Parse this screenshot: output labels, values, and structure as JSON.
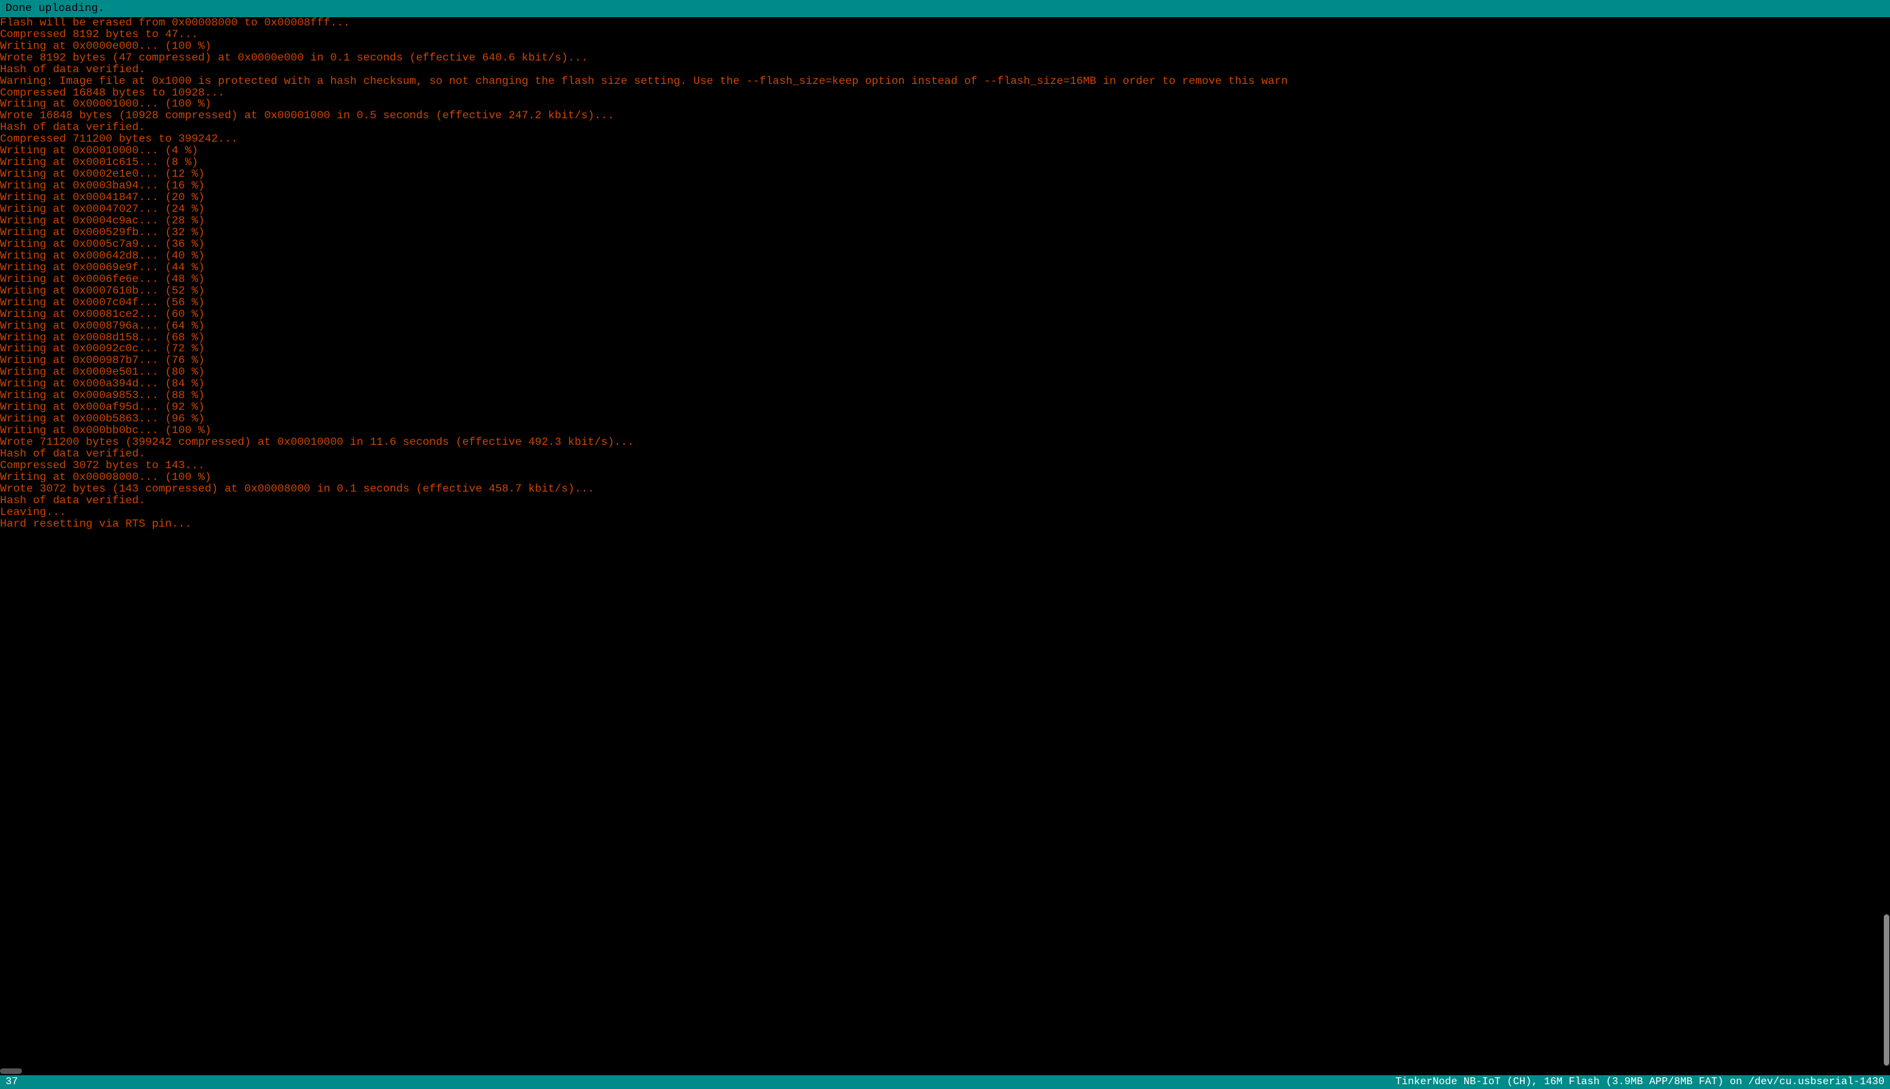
{
  "titleBar": "Done uploading.",
  "lines": [
    "Flash will be erased from 0x00008000 to 0x00008fff...",
    "Compressed 8192 bytes to 47...",
    "Writing at 0x0000e000... (100 %)",
    "Wrote 8192 bytes (47 compressed) at 0x0000e000 in 0.1 seconds (effective 640.6 kbit/s)...",
    "Hash of data verified.",
    "Warning: Image file at 0x1000 is protected with a hash checksum, so not changing the flash size setting. Use the --flash_size=keep option instead of --flash_size=16MB in order to remove this warn",
    "Compressed 16848 bytes to 10928...",
    "Writing at 0x00001000... (100 %)",
    "Wrote 16848 bytes (10928 compressed) at 0x00001000 in 0.5 seconds (effective 247.2 kbit/s)...",
    "Hash of data verified.",
    "Compressed 711200 bytes to 399242...",
    "Writing at 0x00010000... (4 %)",
    "Writing at 0x0001c615... (8 %)",
    "Writing at 0x0002e1e0... (12 %)",
    "Writing at 0x0003ba94... (16 %)",
    "Writing at 0x00041847... (20 %)",
    "Writing at 0x00047027... (24 %)",
    "Writing at 0x0004c9ac... (28 %)",
    "Writing at 0x000529fb... (32 %)",
    "Writing at 0x0005c7a9... (36 %)",
    "Writing at 0x000642d8... (40 %)",
    "Writing at 0x00069e9f... (44 %)",
    "Writing at 0x0006fe6e... (48 %)",
    "Writing at 0x0007610b... (52 %)",
    "Writing at 0x0007c04f... (56 %)",
    "Writing at 0x00081ce2... (60 %)",
    "Writing at 0x0008796a... (64 %)",
    "Writing at 0x0008d158... (68 %)",
    "Writing at 0x00092c0c... (72 %)",
    "Writing at 0x000987b7... (76 %)",
    "Writing at 0x0009e501... (80 %)",
    "Writing at 0x000a394d... (84 %)",
    "Writing at 0x000a9853... (88 %)",
    "Writing at 0x000af95d... (92 %)",
    "Writing at 0x000b5863... (96 %)",
    "Writing at 0x000bb0bc... (100 %)",
    "Wrote 711200 bytes (399242 compressed) at 0x00010000 in 11.6 seconds (effective 492.3 kbit/s)...",
    "Hash of data verified.",
    "Compressed 3072 bytes to 143...",
    "Writing at 0x00008000... (100 %)",
    "Wrote 3072 bytes (143 compressed) at 0x00008000 in 0.1 seconds (effective 458.7 kbit/s)...",
    "Hash of data verified.",
    "",
    "Leaving...",
    "Hard resetting via RTS pin..."
  ],
  "statusBar": {
    "left": "37",
    "right": "TinkerNode NB-IoT (CH), 16M Flash (3.9MB APP/8MB FAT) on /dev/cu.usbserial-1430"
  }
}
